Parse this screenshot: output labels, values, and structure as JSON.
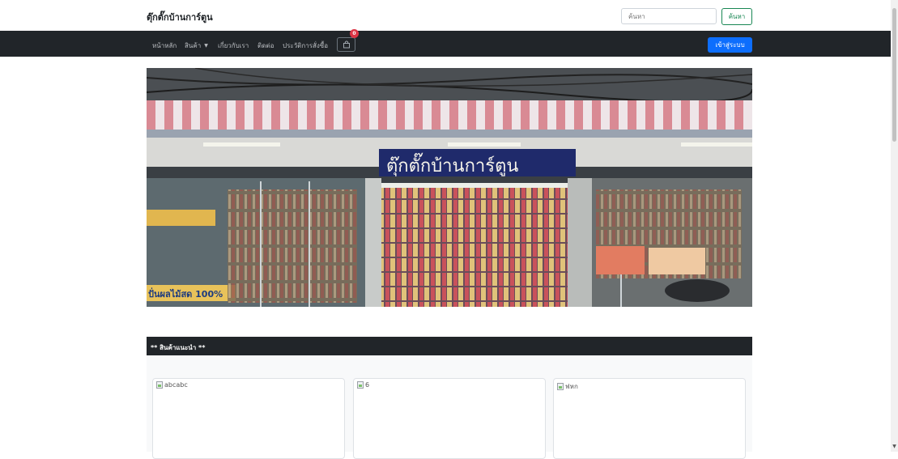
{
  "header": {
    "brand": "ตุ๊กตั๊กบ้านการ์ตูน",
    "search": {
      "placeholder": "ค้นหา",
      "button_label": "ค้นหา"
    }
  },
  "nav": {
    "items": [
      {
        "label": "หน้าหลัก"
      },
      {
        "label": "สินค้า",
        "dropdown": true
      },
      {
        "label": "เกี่ยวกับเรา"
      },
      {
        "label": "ติดต่อ"
      },
      {
        "label": "ประวัติการสั่งซื้อ"
      }
    ],
    "cart": {
      "icon": "shopping-bag-icon",
      "count": "0"
    },
    "login_label": "เข้าสู่ระบบ"
  },
  "hero": {
    "sign_text": "ตุ๊กตั๊กบ้านการ์ตูน",
    "left_sign_text": "ปั่นผลไม้สด 100%"
  },
  "recommended": {
    "title": "** สินค้าแนะนำ **",
    "products": [
      {
        "image_alt": "abcabc"
      },
      {
        "image_alt": "6"
      },
      {
        "image_alt": "ฟหก"
      }
    ]
  },
  "colors": {
    "navbar": "#212529",
    "login_button": "#0d6efd",
    "search_button": "#198754",
    "badge": "#dc3545"
  }
}
